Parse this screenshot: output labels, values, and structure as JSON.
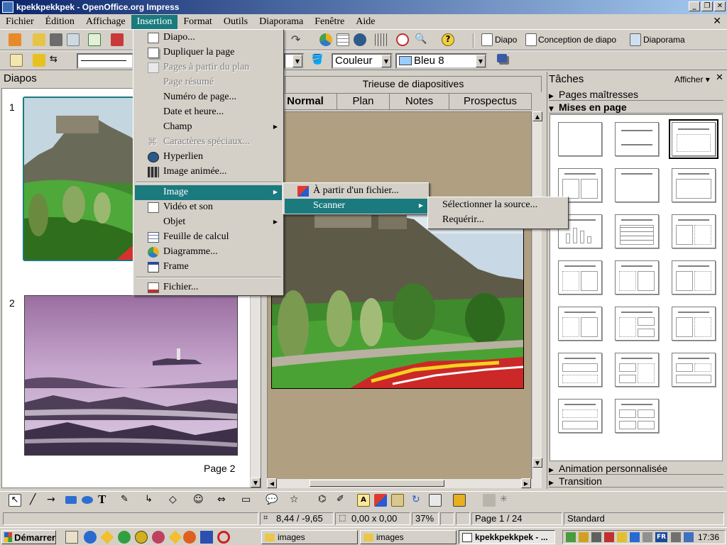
{
  "window": {
    "title": "kpekkpekkpek - OpenOffice.org Impress"
  },
  "menubar": [
    "Fichier",
    "Édition",
    "Affichage",
    "Insertion",
    "Format",
    "Outils",
    "Diaporama",
    "Fenêtre",
    "Aide"
  ],
  "toolbar1": {
    "diapo": "Diapo",
    "conception": "Conception de diapo",
    "diaporama": "Diaporama"
  },
  "toolbar2": {
    "area_style": "Couleur",
    "color": "Bleu 8",
    "color_hex": "#99ccff"
  },
  "slides_panel": {
    "title": "Diapos",
    "slides": [
      {
        "number": "1"
      },
      {
        "number": "2",
        "caption": "Page 2"
      }
    ]
  },
  "views": {
    "trieuse": "Trieuse de diapositives",
    "tabs": [
      "Normal",
      "Plan",
      "Notes",
      "Prospectus"
    ],
    "active_tab": "Normal"
  },
  "tasks": {
    "title": "Tâches",
    "view_menu": "Afficher",
    "sections": [
      "Pages maîtresses",
      "Mises en page",
      "Animation personnalisée",
      "Transition"
    ]
  },
  "insertion_menu": {
    "items": [
      {
        "label": "Diapo...",
        "icon": "new-slide-icon"
      },
      {
        "label": "Dupliquer la page",
        "icon": "duplicate-icon"
      },
      {
        "label": "Pages à partir du plan",
        "icon": "outline-icon",
        "disabled": true
      },
      {
        "label": "Page résumé",
        "disabled": true
      },
      {
        "label": "Numéro de page..."
      },
      {
        "label": "Date et heure..."
      },
      {
        "label": "Champ",
        "submenu": true
      },
      {
        "label": "Caractères spéciaux...",
        "icon": "special-char-icon",
        "disabled": true
      },
      {
        "label": "Hyperlien",
        "icon": "hyperlink-icon"
      },
      {
        "label": "Image animée...",
        "icon": "film-icon"
      },
      {
        "label": "Image",
        "submenu": true,
        "highlighted": true
      },
      {
        "label": "Vidéo et son",
        "icon": "media-icon"
      },
      {
        "label": "Objet",
        "submenu": true
      },
      {
        "label": "Feuille de calcul",
        "icon": "spreadsheet-icon"
      },
      {
        "label": "Diagramme...",
        "icon": "chart-icon"
      },
      {
        "label": "Frame",
        "icon": "frame-icon"
      },
      {
        "label": "Fichier...",
        "icon": "file-icon"
      }
    ]
  },
  "image_submenu": {
    "items": [
      {
        "label": "À partir d'un fichier..."
      },
      {
        "label": "Scanner",
        "submenu": true,
        "highlighted": true
      }
    ]
  },
  "scanner_submenu": {
    "items": [
      {
        "label": "Sélectionner la source..."
      },
      {
        "label": "Requérir..."
      }
    ]
  },
  "status": {
    "position": "8,44 / -9,65",
    "size": "0,00 x 0,00",
    "zoom": "37%",
    "page": "Page 1 / 24",
    "layout": "Standard"
  },
  "taskbar": {
    "start": "Démarrer",
    "tasks": [
      {
        "label": "images"
      },
      {
        "label": "images"
      },
      {
        "label": "kpekkpekkpek - ...",
        "active": true
      }
    ],
    "tray_lang": "FR",
    "clock": "17:36"
  }
}
